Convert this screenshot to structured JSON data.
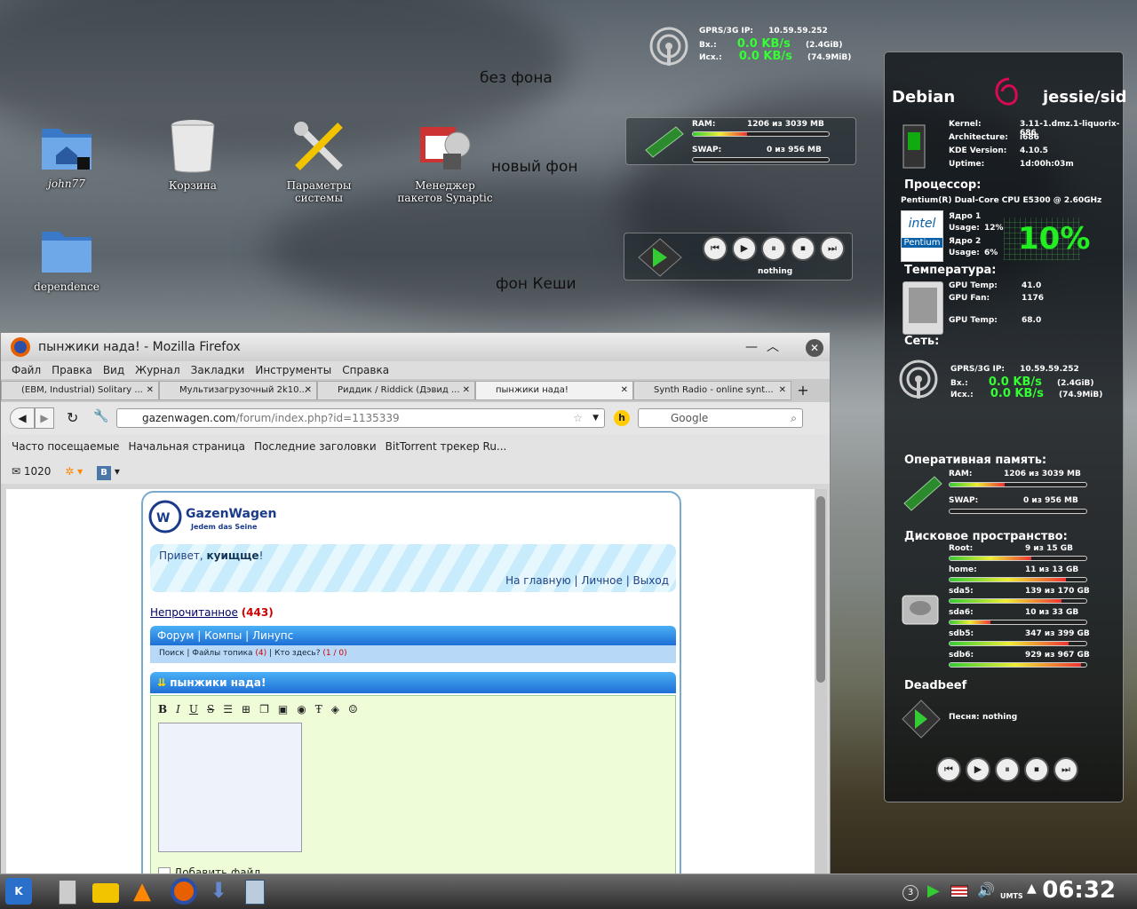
{
  "desktop": {
    "labels": [
      "без фона",
      "новый фон",
      "фон Кеши"
    ],
    "icons": [
      {
        "name": "home-folder-icon",
        "label": "john77"
      },
      {
        "name": "trash-icon",
        "label": "Корзина"
      },
      {
        "name": "system-settings-icon",
        "label": "Параметры системы"
      },
      {
        "name": "synaptic-icon",
        "label": "Менеджер пакетов Synaptic"
      },
      {
        "name": "folder-icon",
        "label": "dependence"
      }
    ]
  },
  "net_widget": {
    "title": "GPRS/3G IP:",
    "ip": "10.59.59.252",
    "in_label": "Вх.:",
    "in_speed": "0.0 KB/s",
    "in_total": "(2.4GiB)",
    "out_label": "Исх.:",
    "out_speed": "0.0 KB/s",
    "out_total": "(74.9MiB)"
  },
  "ram_widget": {
    "ram_label": "RAM:",
    "ram_value": "1206 из 3039 MB",
    "ram_fill": 0.4,
    "swap_label": "SWAP:",
    "swap_value": "0 из 956 MB",
    "swap_fill": 0.0
  },
  "player_widget": {
    "status": "nothing"
  },
  "firefox": {
    "title": "пынжики нада! - Mozilla Firefox",
    "menu": [
      "Файл",
      "Правка",
      "Вид",
      "Журнал",
      "Закладки",
      "Инструменты",
      "Справка"
    ],
    "tabs": [
      "(EBM, Industrial) Solitary ...",
      "Мультизагрузочный 2k10...",
      "Риддик / Riddick (Дэвид ...",
      "пынжики нада!",
      "Synth Radio - online synt..."
    ],
    "url_host": "gazenwagen.com",
    "url_path": "/forum/index.php?id=1135339",
    "search_placeholder": "Google",
    "bookmarks": [
      "Часто посещаемые",
      "Начальная страница",
      "Последние заголовки",
      "BitTorrent трекер Ru..."
    ],
    "mail_count": "1020",
    "vk_label": "B"
  },
  "forum": {
    "logo_title": "GazenWagen",
    "logo_sub": "Jedem das Seine",
    "greeting": "Привет, ",
    "user": "куищще",
    "greeting_end": "!",
    "links": "На главную | Личное | Выход",
    "unread": "Непрочитанное",
    "unread_count": "(443)",
    "breadcrumb": "Форум | Компы | Линупс",
    "sub_search": "Поиск",
    "sub_files": "Файлы топика",
    "sub_files_count": "(4)",
    "sub_who": "Кто здесь?",
    "sub_who_count": "(1 / 0)",
    "topic": "пынжики нада!",
    "toolbar": [
      "B",
      "I",
      "U",
      "S"
    ],
    "attach": "Добавить файл"
  },
  "sysmon": {
    "distro": "Debian",
    "release": "jessie/sid",
    "kernel_label": "Kernel:",
    "kernel": "3.11-1.dmz.1-liquorix-686",
    "arch_label": "Architecture:",
    "arch": "i686",
    "kde_label": "KDE Version:",
    "kde": "4.10.5",
    "uptime_label": "Uptime:",
    "uptime": "1d:00h:03m",
    "cpu_header": "Процессор:",
    "cpu_model": "Pentium(R) Dual-Core CPU   E5300 @ 2.60GHz",
    "core1": "Ядро 1",
    "core1_usage_label": "Usage:",
    "core1_usage": "12%",
    "core2": "Ядро 2",
    "core2_usage_label": "Usage:",
    "core2_usage": "6%",
    "cpu_total": "10%",
    "temp_header": "Температура:",
    "gpu_temp_label": "GPU Temp:",
    "gpu_temp": "41.0",
    "gpu_fan_label": "GPU Fan:",
    "gpu_fan": "1176",
    "gpu_temp2_label": "GPU Temp:",
    "gpu_temp2": "68.0",
    "net_header": "Сеть:",
    "mem_header": "Оперативная память:",
    "disk_header": "Дисковое пространство:",
    "disks": [
      {
        "name": "Root:",
        "value": "9 из 15 GB",
        "fill": 0.6
      },
      {
        "name": "home:",
        "value": "11 из 13 GB",
        "fill": 0.85
      },
      {
        "name": "sda5:",
        "value": "139 из 170 GB",
        "fill": 0.82
      },
      {
        "name": "sda6:",
        "value": "10 из 33 GB",
        "fill": 0.3
      },
      {
        "name": "sdb5:",
        "value": "347 из 399 GB",
        "fill": 0.87
      },
      {
        "name": "sdb6:",
        "value": "929 из 967 GB",
        "fill": 0.96
      }
    ],
    "player_header": "Deadbeef",
    "song_label": "Песня:",
    "song": "nothing"
  },
  "taskbar": {
    "clock": "06:32",
    "tray_count": "3",
    "tray_net": "UMTS"
  }
}
